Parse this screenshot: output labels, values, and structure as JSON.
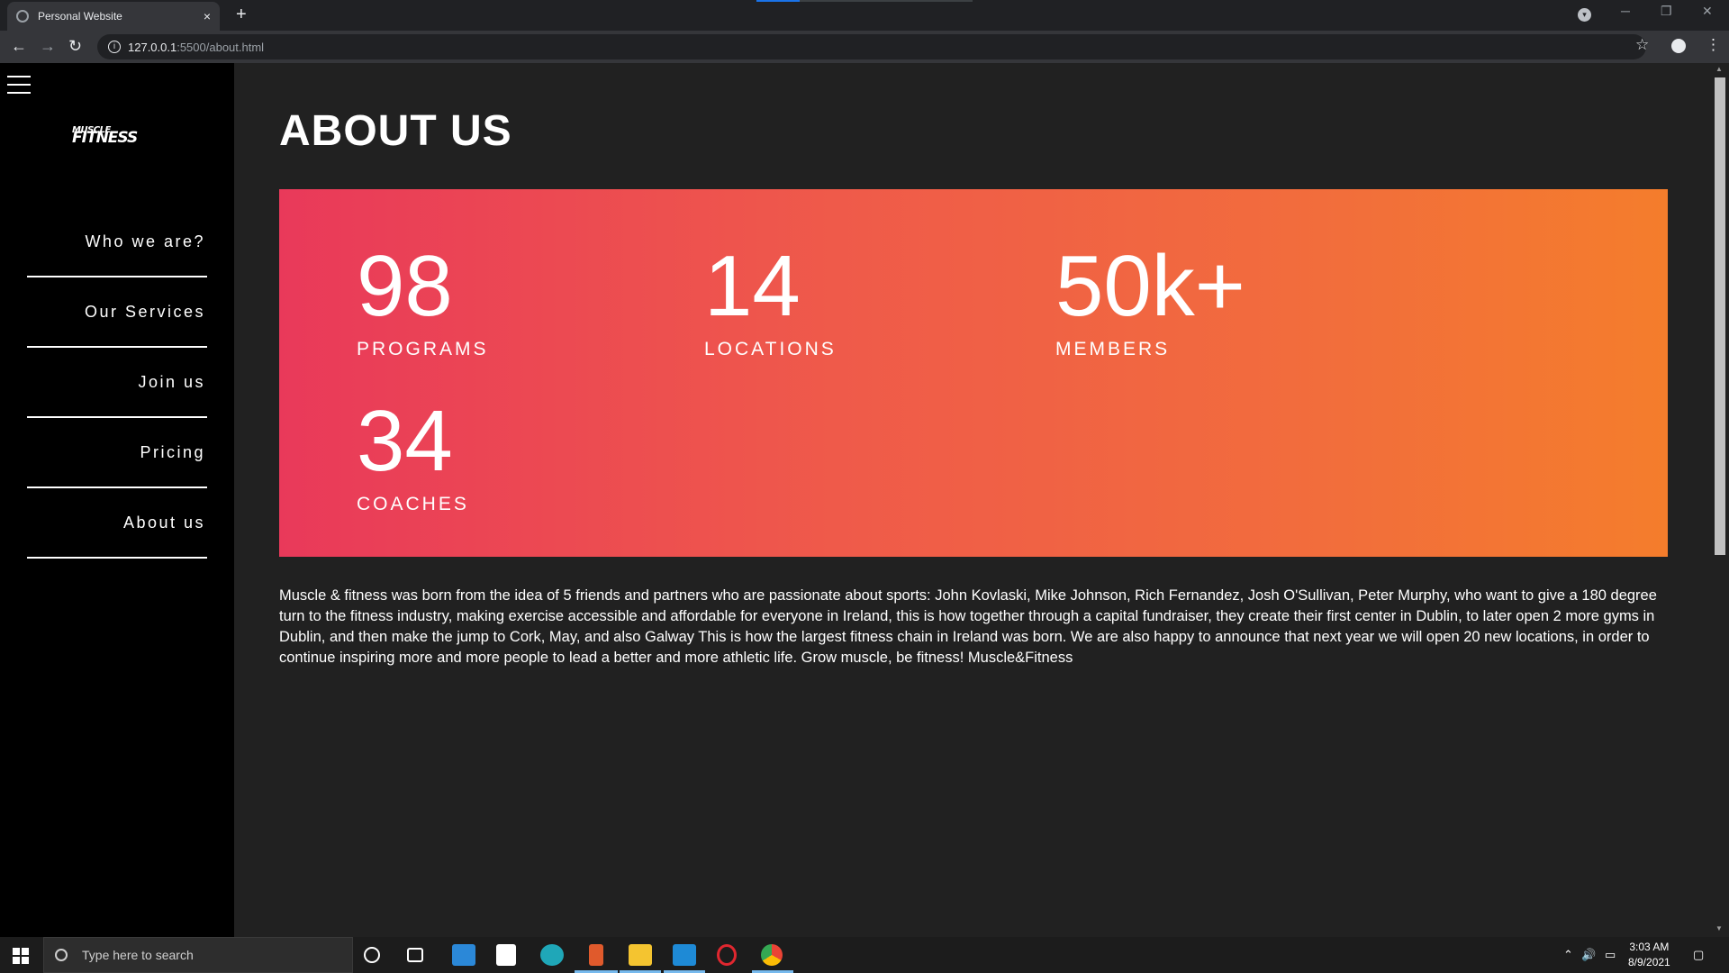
{
  "browser": {
    "tab_title": "Personal Website",
    "tab_close": "×",
    "new_tab": "+",
    "url_host": "127.0.0.1",
    "url_path": ":5500/about.html"
  },
  "sidebar": {
    "logo_line1": "MUSCLE",
    "logo_line2": "FITNESS",
    "items": [
      {
        "label": "Who we are?"
      },
      {
        "label": "Our Services"
      },
      {
        "label": "Join us"
      },
      {
        "label": "Pricing"
      },
      {
        "label": "About us"
      }
    ]
  },
  "main": {
    "heading": "ABOUT US",
    "stats": [
      {
        "value": "98",
        "label": "PROGRAMS"
      },
      {
        "value": "14",
        "label": "LOCATIONS"
      },
      {
        "value": "50k+",
        "label": "MEMBERS"
      },
      {
        "value": "34",
        "label": "COACHES"
      }
    ],
    "gradient_colors": [
      "#e9395a",
      "#f47d2c"
    ],
    "paragraph": "Muscle & fitness was born from the idea of 5 friends and partners who are passionate about sports: John Kovlaski, Mike Johnson, Rich Fernandez, Josh O'Sullivan, Peter Murphy, who want to give a 180 degree turn to the fitness industry, making exercise accessible and affordable for everyone in Ireland, this is how together through a capital fundraiser, they create their first center in Dublin, to later open 2 more gyms in Dublin, and then make the jump to Cork, May, and also Galway This is how the largest fitness chain in Ireland was born. We are also happy to announce that next year we will open 20 new locations, in order to continue inspiring more and more people to lead a better and more athletic life. Grow muscle, be fitness! Muscle&Fitness"
  },
  "taskbar": {
    "search_placeholder": "Type here to search",
    "time": "3:03 AM",
    "date": "8/9/2021"
  }
}
